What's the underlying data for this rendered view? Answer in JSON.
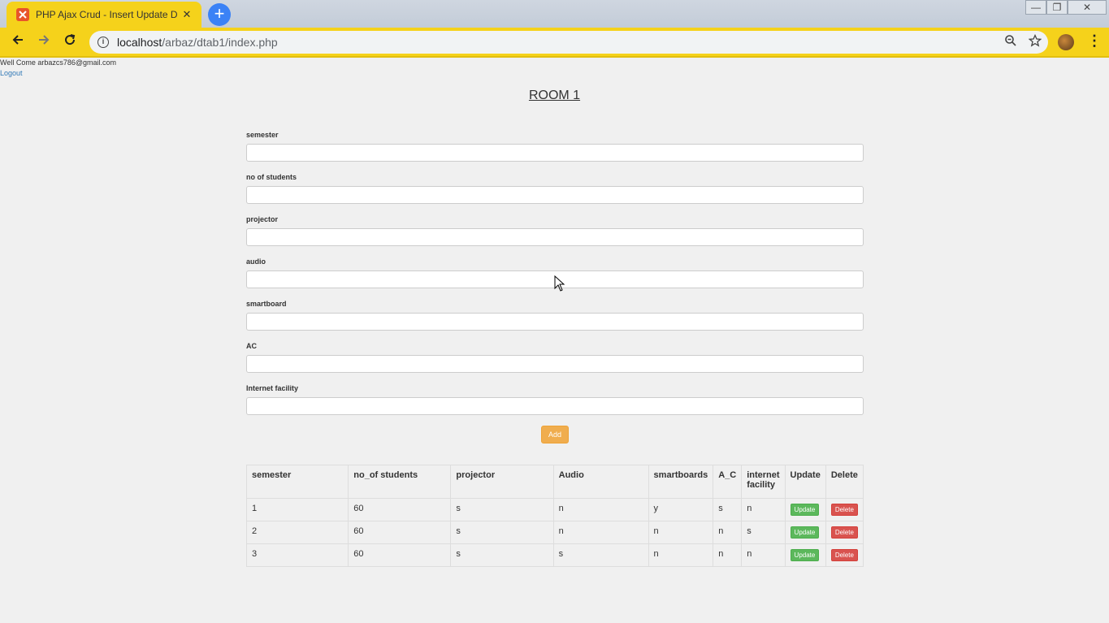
{
  "browser": {
    "tab_title": "PHP Ajax Crud - Insert Update D",
    "tab_close": "✕",
    "new_tab": "+",
    "url_host": "localhost",
    "url_path": "/arbaz/dtab1/index.php",
    "window_controls": [
      "—",
      "❐",
      "✕"
    ]
  },
  "header": {
    "welcome": "Well Come arbazcs786@gmail.com",
    "logout": "Logout"
  },
  "page": {
    "title": "ROOM 1"
  },
  "form": {
    "fields": [
      {
        "label": "semester",
        "value": ""
      },
      {
        "label": "no of students",
        "value": ""
      },
      {
        "label": "projector",
        "value": ""
      },
      {
        "label": "audio",
        "value": ""
      },
      {
        "label": "smartboard",
        "value": ""
      },
      {
        "label": "AC",
        "value": ""
      },
      {
        "label": "Internet facility",
        "value": ""
      }
    ],
    "add_label": "Add"
  },
  "table": {
    "headers": [
      "semester",
      "no_of students",
      "projector",
      "Audio",
      "smartboards",
      "A_C",
      "internet facility",
      "Update",
      "Delete"
    ],
    "rows": [
      [
        "1",
        "60",
        "s",
        "n",
        "y",
        "s",
        "n"
      ],
      [
        "2",
        "60",
        "s",
        "n",
        "n",
        "n",
        "s"
      ],
      [
        "3",
        "60",
        "s",
        "s",
        "n",
        "n",
        "n"
      ]
    ],
    "update_label": "Update",
    "delete_label": "Delete"
  },
  "colors": {
    "chrome_accent": "#f5d21b",
    "add_button": "#f0ad4e",
    "update_button": "#5cb85c",
    "delete_button": "#d9534f"
  }
}
